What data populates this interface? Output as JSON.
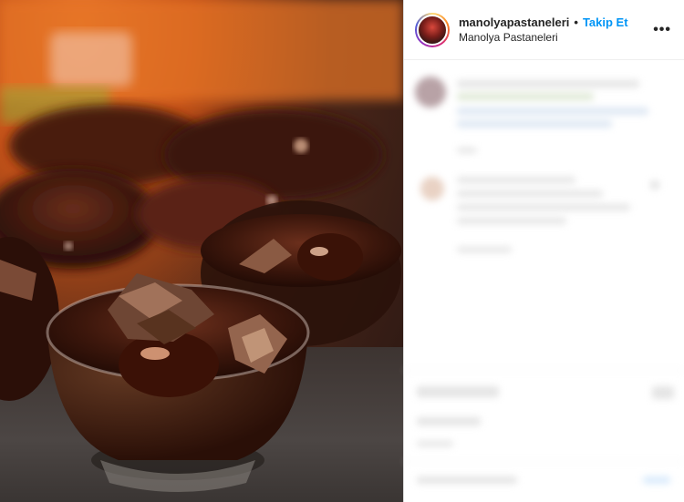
{
  "profile": {
    "username": "manolyapastaneleri",
    "separator": "•",
    "follow_label": "Takip Et",
    "display_name": "Manolya Pastaneleri",
    "more_icon": "more-options-icon"
  },
  "media": {
    "subject": "chocolate-pudding-cups-photo"
  },
  "colors": {
    "follow": "#0095f6",
    "text": "#262626",
    "border": "#dbdbdb"
  }
}
